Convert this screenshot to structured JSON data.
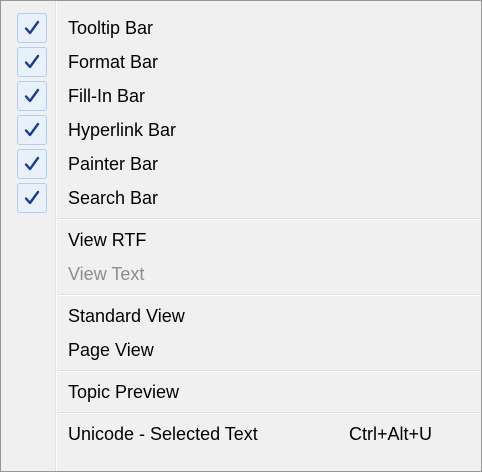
{
  "menu": {
    "toolbar_items": [
      {
        "label": "Tooltip Bar",
        "checked": true
      },
      {
        "label": "Format Bar",
        "checked": true
      },
      {
        "label": "Fill-In Bar",
        "checked": true
      },
      {
        "label": "Hyperlink Bar",
        "checked": true
      },
      {
        "label": "Painter Bar",
        "checked": true
      },
      {
        "label": "Search Bar",
        "checked": true
      }
    ],
    "view_items": [
      {
        "label": "View RTF",
        "enabled": true
      },
      {
        "label": "View Text",
        "enabled": false
      }
    ],
    "layout_items": [
      {
        "label": "Standard View"
      },
      {
        "label": "Page View"
      }
    ],
    "preview_items": [
      {
        "label": "Topic Preview"
      }
    ],
    "unicode_item": {
      "label": "Unicode - Selected Text",
      "shortcut": "Ctrl+Alt+U"
    }
  },
  "colors": {
    "menu_background": "#f0f0f0",
    "check_color": "#1b3d8f",
    "check_box_fill": "#e8f0fa",
    "disabled_text": "#8d8d8d"
  },
  "icons": {
    "check": "checkmark-icon"
  }
}
